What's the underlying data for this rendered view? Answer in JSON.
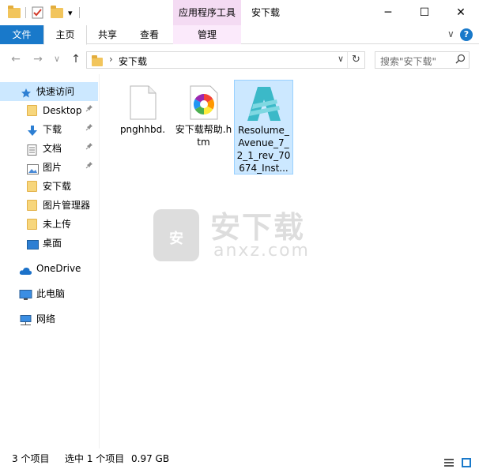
{
  "window": {
    "title": "安下载",
    "context_tab_title": "应用程序工具"
  },
  "quick_access_toolbar": {
    "dropdown_glyph": "▾"
  },
  "window_controls": {
    "minimize": "─",
    "maximize": "☐",
    "close": "✕"
  },
  "ribbon": {
    "tabs": [
      "文件",
      "主页",
      "共享",
      "查看",
      "管理"
    ],
    "collapse_glyph": "∨",
    "help_glyph": "?"
  },
  "nav": {
    "back": "←",
    "forward": "→",
    "recent": "∨",
    "up": "↑"
  },
  "address": {
    "separator": "›",
    "crumb": "安下载",
    "dropdown": "∨",
    "refresh": "↻"
  },
  "search": {
    "placeholder": "搜索\"安下载\"",
    "icon": "⚲"
  },
  "sidebar": {
    "items": [
      {
        "label": "快速访问",
        "icon": "star-icon"
      },
      {
        "label": "Desktop",
        "icon": "folder-icon",
        "pinned": true
      },
      {
        "label": "下载",
        "icon": "download-arrow-icon",
        "pinned": true
      },
      {
        "label": "文档",
        "icon": "document-icon",
        "pinned": true
      },
      {
        "label": "图片",
        "icon": "picture-icon",
        "pinned": true
      },
      {
        "label": "安下载",
        "icon": "folder-icon"
      },
      {
        "label": "图片管理器",
        "icon": "folder-icon"
      },
      {
        "label": "未上传",
        "icon": "folder-icon"
      },
      {
        "label": "桌面",
        "icon": "desktop-icon"
      },
      {
        "label": "OneDrive",
        "icon": "cloud-icon"
      },
      {
        "label": "此电脑",
        "icon": "computer-icon"
      },
      {
        "label": "网络",
        "icon": "network-icon"
      }
    ],
    "pin_glyph": "📌"
  },
  "files": [
    {
      "name": "pnghhbd.",
      "icon": "blank-file-icon",
      "selected": false
    },
    {
      "name": "安下载帮助.htm",
      "icon": "color-wheel-icon",
      "selected": false
    },
    {
      "name": "Resolume_Avenue_7_2_1_rev_70674_Inst...",
      "icon": "resolume-avenue-icon",
      "selected": true
    }
  ],
  "watermark": {
    "logo_char": "安",
    "brand": "安下载",
    "url": "anxz.com"
  },
  "status": {
    "item_count": "3 个项目",
    "selection": "选中 1 个项目",
    "size": "0.97 GB"
  },
  "colors": {
    "accent": "#1979ca",
    "selection": "#cce8ff",
    "context_tab": "#f4dbf3"
  }
}
